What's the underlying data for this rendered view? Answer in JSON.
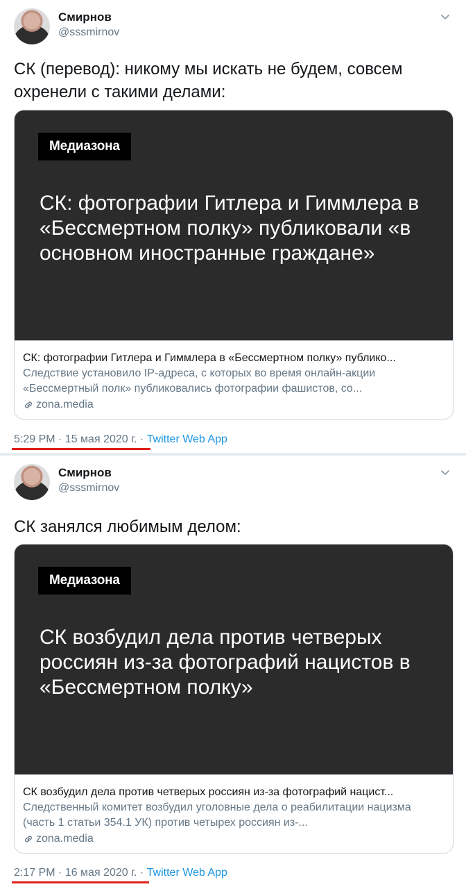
{
  "tweets": [
    {
      "name": "Смирнов",
      "handle": "@sssmirnov",
      "text": "СК (перевод): никому мы искать не будем, совсем охренели с такими делами:",
      "card": {
        "logo": "Медиазона",
        "headline": "СК: фотографии Гитлера и Гиммлера в «Бессмертном полку» публиковали «в основном иностранные граждане»",
        "title": "СК: фотографии Гитлера и Гиммлера в «Бессмертном полку» публико...",
        "description": "Следствие установило IP-адреса, с которых во время онлайн-акции «Бессмертный полк» публиковались фотографии фашистов, со...",
        "domain": "zona.media"
      },
      "timestamp": "5:29 PM · 15 мая 2020 г.",
      "separator": "·",
      "source": "Twitter Web App"
    },
    {
      "name": "Смирнов",
      "handle": "@sssmirnov",
      "text": "СК занялся любимым делом:",
      "card": {
        "logo": "Медиазона",
        "headline": "СК возбудил дела против четверых россиян из-за фотографий нацистов в «Бессмертном полку»",
        "title": "СК возбудил дела против четверых россиян из-за фотографий нацист...",
        "description": "Следственный комитет возбудил уголовные дела о реабилитации нацизма (часть 1 статьи 354.1 УК) против четырех россиян из-...",
        "domain": "zona.media"
      },
      "timestamp": "2:17 PM · 16 мая 2020 г.",
      "separator": "·",
      "source": "Twitter Web App"
    }
  ],
  "icons": {
    "menu": "chevron-down-icon",
    "link": "link-icon"
  },
  "colors": {
    "link_blue": "#1b95e0",
    "secondary_text": "#657786",
    "highlight_underline": "#e0201a",
    "card_background": "#2b2b2b"
  }
}
